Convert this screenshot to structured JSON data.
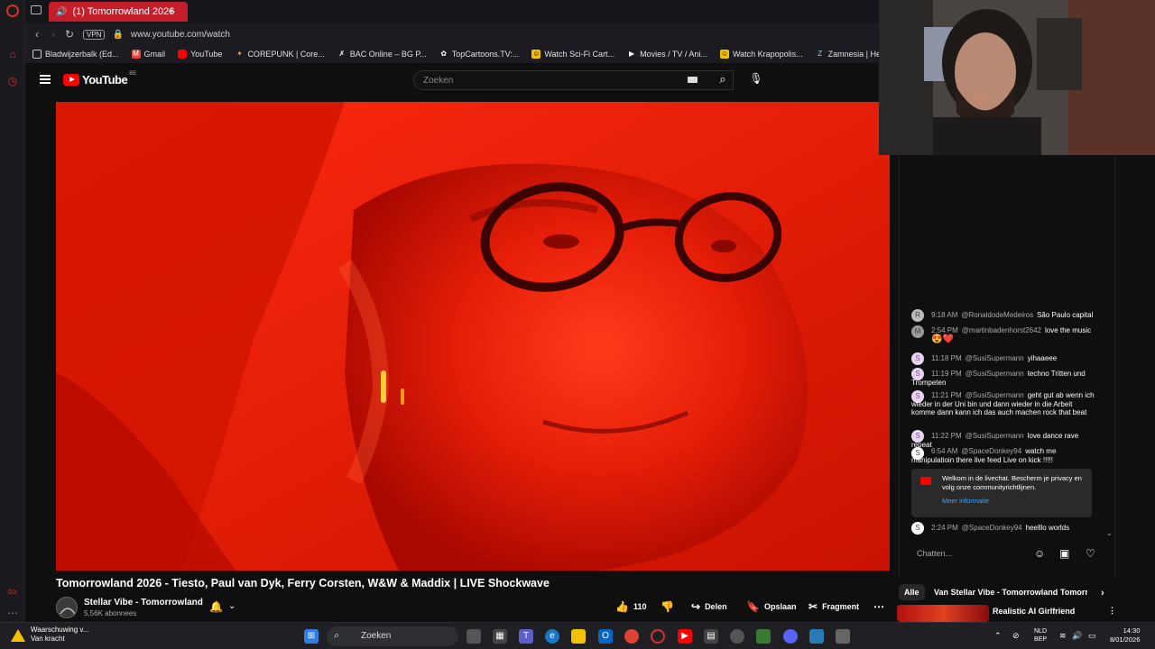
{
  "browser": {
    "tab_title": "(1) Tomorrowland 2026",
    "url": "www.youtube.com/watch",
    "vpn_label": "VPN",
    "bookmarks": [
      {
        "label": "Bladwijzerbalk (Ed...",
        "icon": "folder-icon"
      },
      {
        "label": "Gmail",
        "icon": "gmail-icon"
      },
      {
        "label": "YouTube",
        "icon": "youtube-icon"
      },
      {
        "label": "COREPUNK | Core...",
        "icon": "corepunk-icon"
      },
      {
        "label": "BAC Online – BG P...",
        "icon": "bac-icon"
      },
      {
        "label": "TopCartoons.TV:...",
        "icon": "topcartoons-icon"
      },
      {
        "label": "Watch Sci-Fi Cart...",
        "icon": "scifi-icon"
      },
      {
        "label": "Movies / TV / Ani...",
        "icon": "play-icon"
      },
      {
        "label": "Watch Krapopolis...",
        "icon": "krapopolis-icon"
      },
      {
        "label": "Zamnesia | Het Be...",
        "icon": "zamnesia-icon"
      }
    ]
  },
  "youtube": {
    "logo_text": "YouTube",
    "country_code": "BE",
    "search_placeholder": "Zoeken"
  },
  "video": {
    "title": "Tomorrowland 2026 - Tiesto, Paul van Dyk, Ferry Corsten, W&W & Maddix | LIVE Shockwave",
    "channel": "Stellar Vibe - Tomorrowland",
    "subscribers": "5,56K abonnees",
    "likes": "110",
    "share_label": "Delen",
    "save_label": "Opslaan",
    "clip_label": "Fragment"
  },
  "chat": {
    "messages": [
      {
        "time": "9:18 AM",
        "author": "@RonaldodeMedeiros",
        "text": "São Paulo capital",
        "avatar": "R"
      },
      {
        "time": "2:54 PM",
        "author": "@martinbadenhorst2642",
        "text": "love the music",
        "avatar": "M",
        "emoji": "😍❤️"
      },
      {
        "time": "11:18 PM",
        "author": "@SusiSupermann",
        "text": "yihaaeee",
        "avatar": "S"
      },
      {
        "time": "11:19 PM",
        "author": "@SusiSupermann",
        "text": "techno Tritten und Trompeten",
        "avatar": "S"
      },
      {
        "time": "11:21 PM",
        "author": "@SusiSupermann",
        "text": "geht gut ab wenn ich wieder in der Uni bin und dann wieder in die Arbeit komme dann kann ich das auch machen rock that beat",
        "avatar": "S"
      },
      {
        "time": "11:22 PM",
        "author": "@SusiSupermann",
        "text": "love dance rave repeat",
        "avatar": "S"
      },
      {
        "time": "6:54 AM",
        "author": "@SpaceDonkey94",
        "text": "watch me manipulatioin there live feed Live on kick !!!!!",
        "avatar": "S"
      },
      {
        "time": "2:24 PM",
        "author": "@SpaceDonkey94",
        "text": "heelllo worlds",
        "avatar": "S"
      }
    ],
    "welcome_text": "Welkom in de livechat. Bescherm je privacy en volg onze communityrichtlijnen.",
    "welcome_link": "Meer informatie",
    "input_placeholder": "Chatten..."
  },
  "related": {
    "chips": [
      "Alle",
      "Van Stellar Vibe - Tomorrowland",
      "Tomorr"
    ],
    "first_title": "Realistic AI Girlfriend"
  },
  "taskbar": {
    "warning_title": "Waarschuwing v...",
    "warning_sub": "Van kracht",
    "search_label": "Zoeken",
    "lang_line1": "NLD",
    "lang_line2": "BEP",
    "time": "14:30",
    "date": "8/01/2026"
  },
  "colors": {
    "accent_red": "#c41e2a",
    "youtube_red": "#ff0000",
    "link_blue": "#3ea6ff",
    "video_red": "#c40c00"
  }
}
